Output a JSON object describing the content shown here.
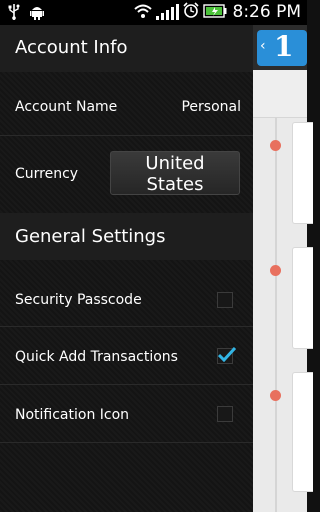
{
  "status_bar": {
    "icons": [
      "usb-icon",
      "android-debug-icon",
      "wifi-icon",
      "signal-icon",
      "alarm-icon",
      "battery-icon"
    ],
    "time": "8:26 PM"
  },
  "account_info": {
    "header": "Account Info",
    "account_name_label": "Account Name",
    "account_name_value": "Personal",
    "currency_label": "Currency",
    "currency_value": "United States"
  },
  "general_settings": {
    "header": "General Settings",
    "items": [
      {
        "label": "Security Passcode",
        "checked": false
      },
      {
        "label": "Quick Add Transactions",
        "checked": true
      },
      {
        "label": "Notification Icon",
        "checked": false
      }
    ]
  },
  "app": {
    "icon_letter": "1",
    "chevron": "‹"
  },
  "colors": {
    "accent_blue": "#2a8fd8",
    "check_blue": "#33b5e5",
    "timeline_dot": "#e8705e"
  }
}
